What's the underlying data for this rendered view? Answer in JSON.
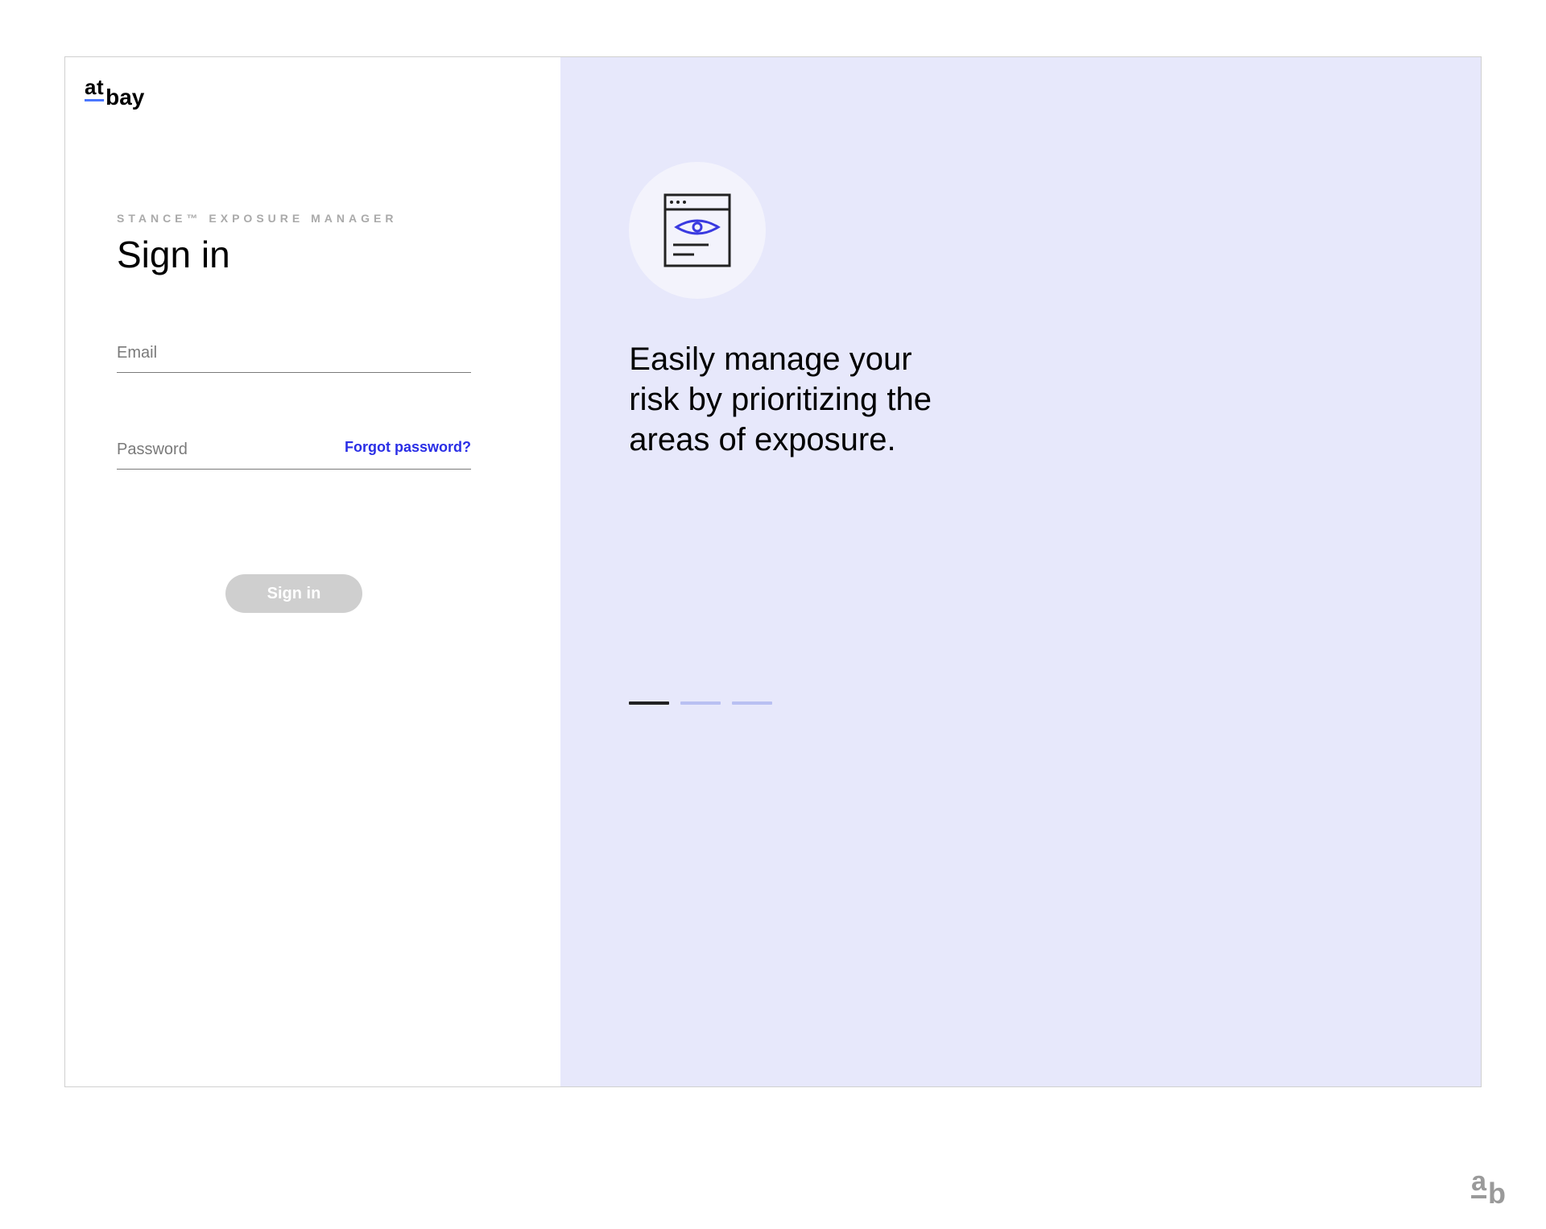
{
  "logo": {
    "part1": "at",
    "part2": "bay"
  },
  "form": {
    "overline": "STANCE™ EXPOSURE MANAGER",
    "title": "Sign in",
    "email": {
      "placeholder": "Email",
      "value": ""
    },
    "password": {
      "placeholder": "Password",
      "value": ""
    },
    "forgot_label": "Forgot password?",
    "submit_label": "Sign in"
  },
  "promo": {
    "headline": "Easily manage your risk by prioritizing the areas of exposure.",
    "icon_name": "browser-eye-icon",
    "active_slide": 0,
    "slide_count": 3
  },
  "watermark": {
    "part1": "a",
    "part2": "b"
  }
}
